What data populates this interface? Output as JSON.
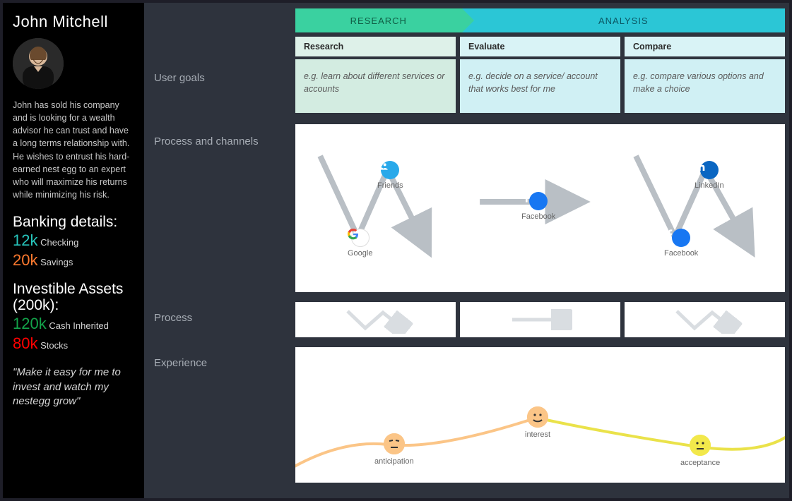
{
  "persona": {
    "name": "John Mitchell",
    "description": "John has sold his company and is looking for a wealth advisor he can trust and have a long terms relationship with. He wishes to entrust his hard-earned nest egg to an expert who will maximize his returns while minimizing his risk.",
    "banking_title": "Banking details:",
    "banking": [
      {
        "amount": "12k",
        "label": "Checking",
        "color": "teal"
      },
      {
        "amount": "20k",
        "label": "Savings",
        "color": "orange"
      }
    ],
    "assets_title": "Investible Assets (200k):",
    "assets": [
      {
        "amount": "120k",
        "label": "Cash Inherited",
        "color": "green"
      },
      {
        "amount": "80k",
        "label": "Stocks",
        "color": "red"
      }
    ],
    "quote": "\"Make it easy for me to invest and watch my nestegg grow\""
  },
  "rows": {
    "goals": "User goals",
    "channels": "Process and channels",
    "process": "Process",
    "experience": "Experience"
  },
  "phases": {
    "research": "RESEARCH",
    "analysis": "ANALYSIS"
  },
  "columns": [
    {
      "head": "Research",
      "goal": "e.g. learn about different services or accounts"
    },
    {
      "head": "Evaluate",
      "goal": "e.g. decide on a service/ account that works best for me"
    },
    {
      "head": "Compare",
      "goal": "e.g. compare various options and make a choice"
    }
  ],
  "channels": {
    "friends": "Friends",
    "google": "Google",
    "facebook": "Facebook",
    "linkedin": "LinkedIn"
  },
  "experience": {
    "anticipation": "anticipation",
    "interest": "interest",
    "acceptance": "acceptance"
  }
}
